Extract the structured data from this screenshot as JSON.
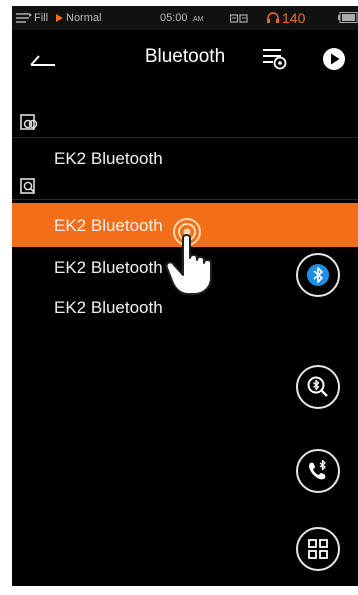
{
  "status_bar": {
    "playlist": "Fill",
    "play_mode": "Normal",
    "time": "05:00",
    "ampm": "AM",
    "battery": "140"
  },
  "header": {
    "title": "Bluetooth"
  },
  "paired": {
    "devices": [
      {
        "name": "EK2 Bluetooth"
      }
    ]
  },
  "available": {
    "devices": [
      {
        "name": "EK2 Bluetooth",
        "selected": true
      },
      {
        "name": "EK2 Bluetooth",
        "selected": false
      },
      {
        "name": "EK2 Bluetooth",
        "selected": false
      }
    ]
  },
  "colors": {
    "accent": "#f26f1a",
    "background": "#000000",
    "fab_active": "#1e8fe6"
  },
  "icons": {
    "back": "back-arrow-icon",
    "filter": "filter-settings-icon",
    "play": "play-icon",
    "paired_section": "paired-devices-icon",
    "search_section": "search-devices-icon",
    "fab_bluetooth": "bluetooth-icon",
    "fab_search": "bluetooth-search-icon",
    "fab_call": "bluetooth-call-icon",
    "fab_grid": "grid-menu-icon",
    "pointer": "tap-hand-pointer-icon"
  }
}
